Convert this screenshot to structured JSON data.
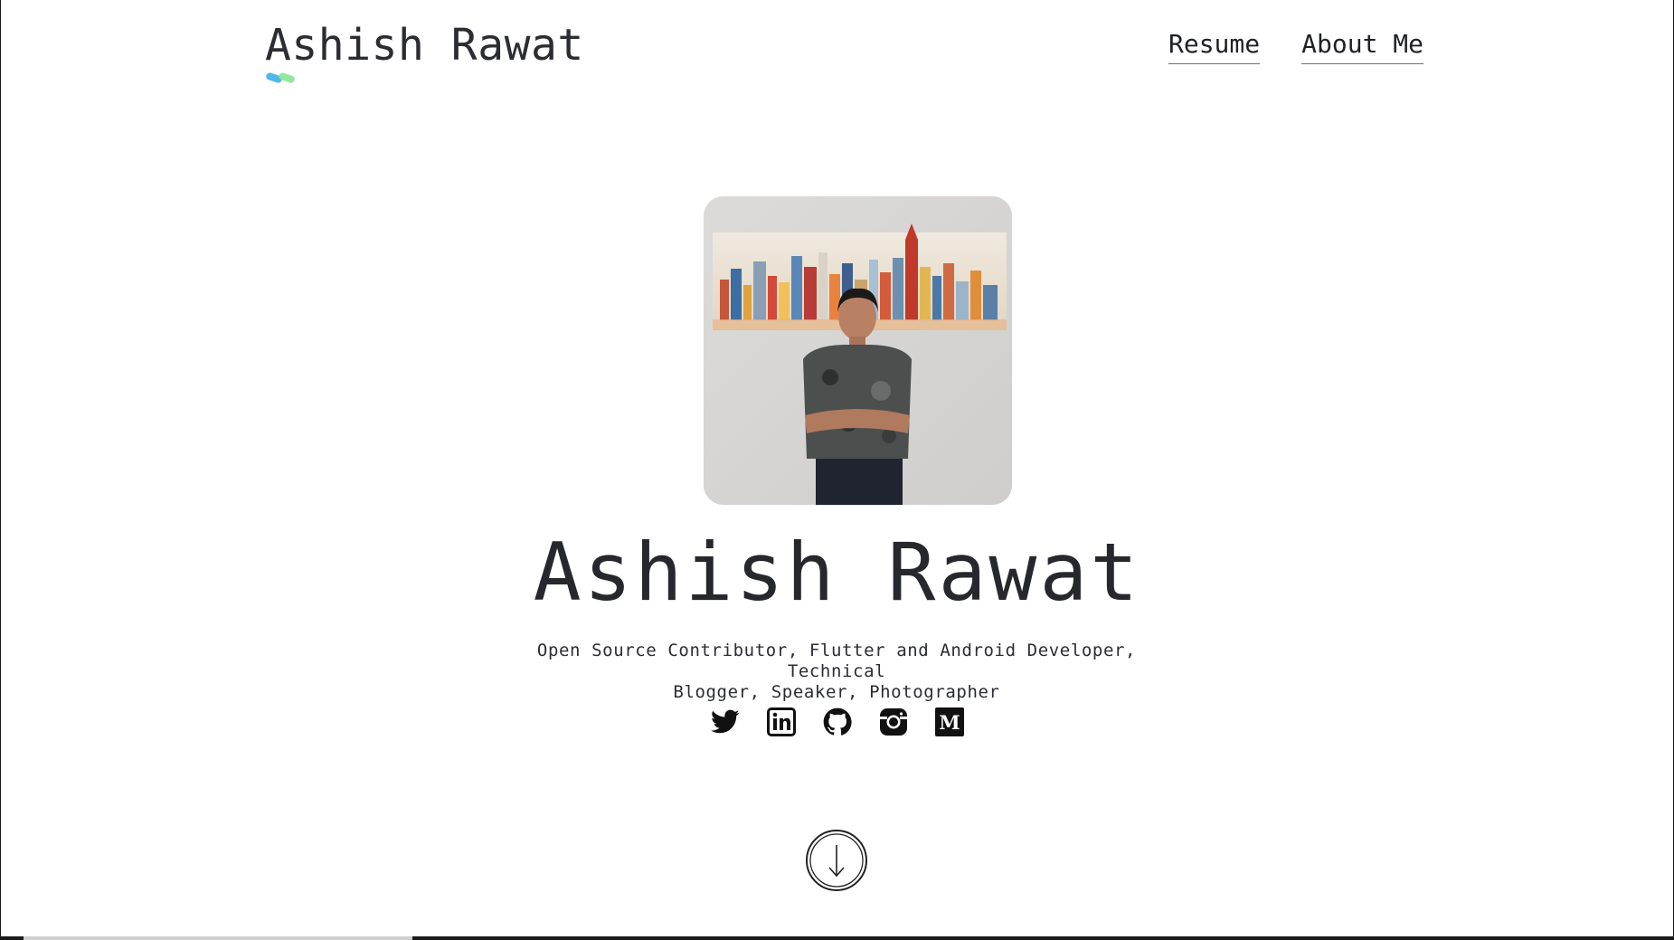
{
  "header": {
    "logo_text": "Ashish Rawat",
    "nav": [
      {
        "label": "Resume"
      },
      {
        "label": "About Me"
      }
    ]
  },
  "hero": {
    "name": "Ashish Rawat",
    "tagline_line1": "Open Source Contributor, Flutter and Android Developer, Technical",
    "tagline_line2": "Blogger, Speaker, Photographer"
  },
  "socials": [
    {
      "icon": "twitter-icon"
    },
    {
      "icon": "linkedin-icon"
    },
    {
      "icon": "github-icon"
    },
    {
      "icon": "instagram-icon"
    },
    {
      "icon": "medium-icon"
    }
  ],
  "scroll": {
    "icon": "arrow-down-icon"
  },
  "colors": {
    "text": "#2b2d33",
    "logo_mark_blue": "#4fb6f0",
    "logo_mark_green": "#8ee69a"
  }
}
